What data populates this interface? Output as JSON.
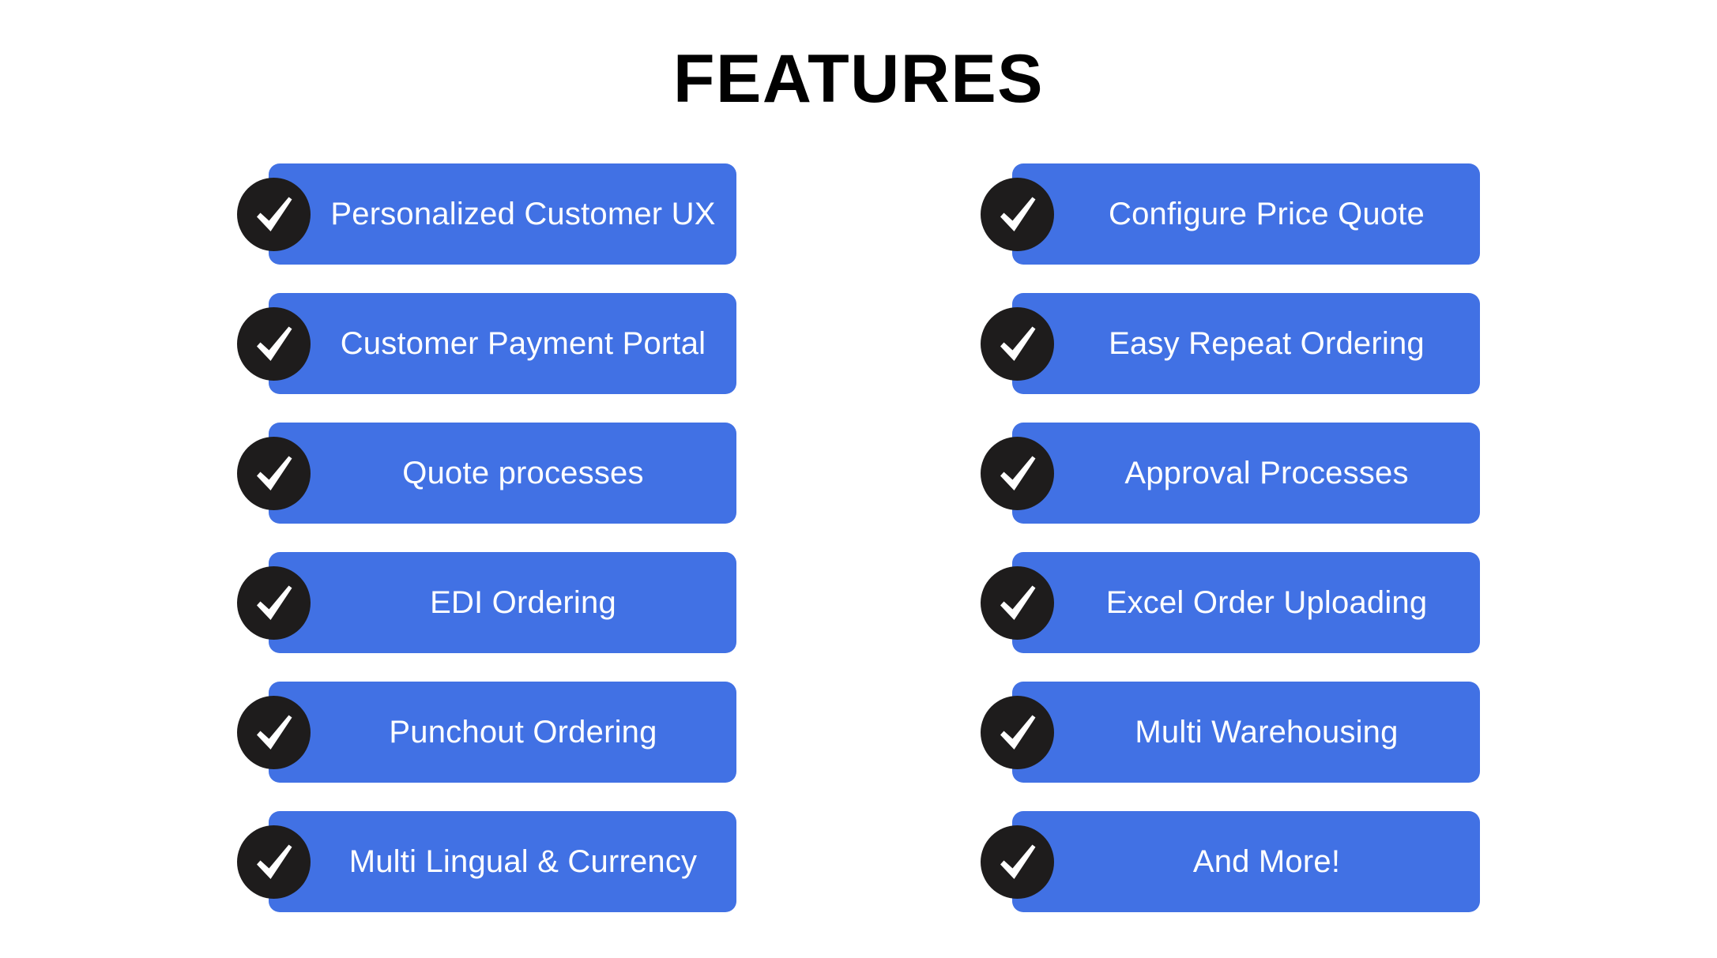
{
  "page": {
    "title": "FEATURES",
    "background_color": "#ffffff",
    "title_color": "#010101"
  },
  "theme": {
    "pill_color": "#4171E4",
    "badge_color": "#1E1C1C",
    "label_color": "#ffffff",
    "check_icon": "check-icon"
  },
  "columns": [
    {
      "name": "left-column",
      "features": [
        {
          "label": "Personalized Customer UX"
        },
        {
          "label": "Customer Payment Portal"
        },
        {
          "label": "Quote processes"
        },
        {
          "label": "EDI Ordering"
        },
        {
          "label": "Punchout Ordering"
        },
        {
          "label": "Multi Lingual & Currency"
        }
      ]
    },
    {
      "name": "right-column",
      "features": [
        {
          "label": "Configure Price Quote"
        },
        {
          "label": "Easy Repeat Ordering"
        },
        {
          "label": "Approval Processes"
        },
        {
          "label": "Excel Order Uploading"
        },
        {
          "label": "Multi Warehousing"
        },
        {
          "label": "And More!"
        }
      ]
    }
  ]
}
